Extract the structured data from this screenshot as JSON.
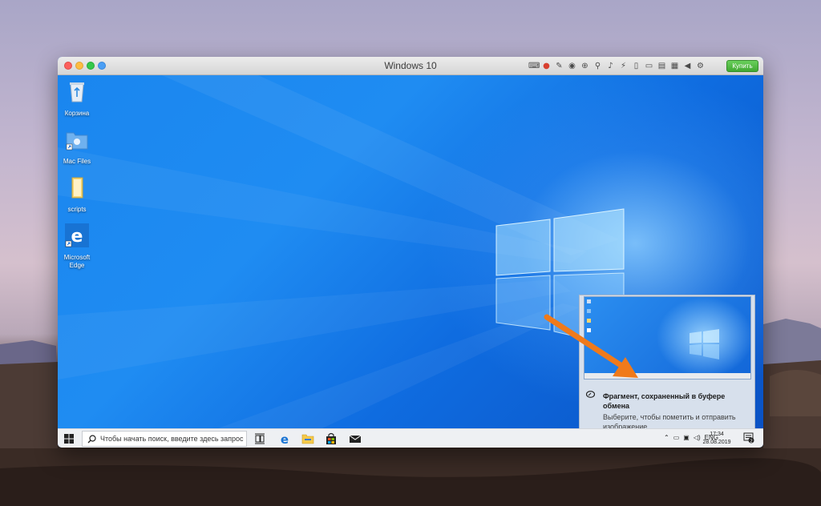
{
  "window": {
    "title": "Windows 10",
    "buy_label": "Купить"
  },
  "toolbar_icons": [
    "keyboard-icon",
    "record-icon",
    "pen-icon",
    "camera-icon",
    "target-icon",
    "network-icon",
    "volume-icon",
    "usb-icon",
    "mobile-icon",
    "printer-icon",
    "folder-share-icon",
    "printer2-icon",
    "play-icon",
    "gear-icon"
  ],
  "desktop_icons": [
    {
      "name": "recycle-bin",
      "label": "Корзина"
    },
    {
      "name": "mac-files",
      "label": "Mac Files"
    },
    {
      "name": "scripts",
      "label": "scripts"
    },
    {
      "name": "microsoft-edge",
      "label": "Microsoft Edge"
    }
  ],
  "notification": {
    "title": "Фрагмент, сохраненный в буфере обмена",
    "text": "Выберите, чтобы пометить и отправить изображение"
  },
  "taskbar": {
    "search_placeholder": "Чтобы начать поиск, введите здесь запрос",
    "apps": [
      "task-view-icon",
      "edge-icon",
      "file-explorer-icon",
      "store-icon",
      "mail-icon"
    ],
    "tray_lang": "ENG",
    "time": "17:34",
    "date": "28.08.2019",
    "notification_count": "2"
  },
  "colors": {
    "accent": "#1570d8",
    "arrow": "#f07a1a",
    "buy": "#41a832"
  }
}
